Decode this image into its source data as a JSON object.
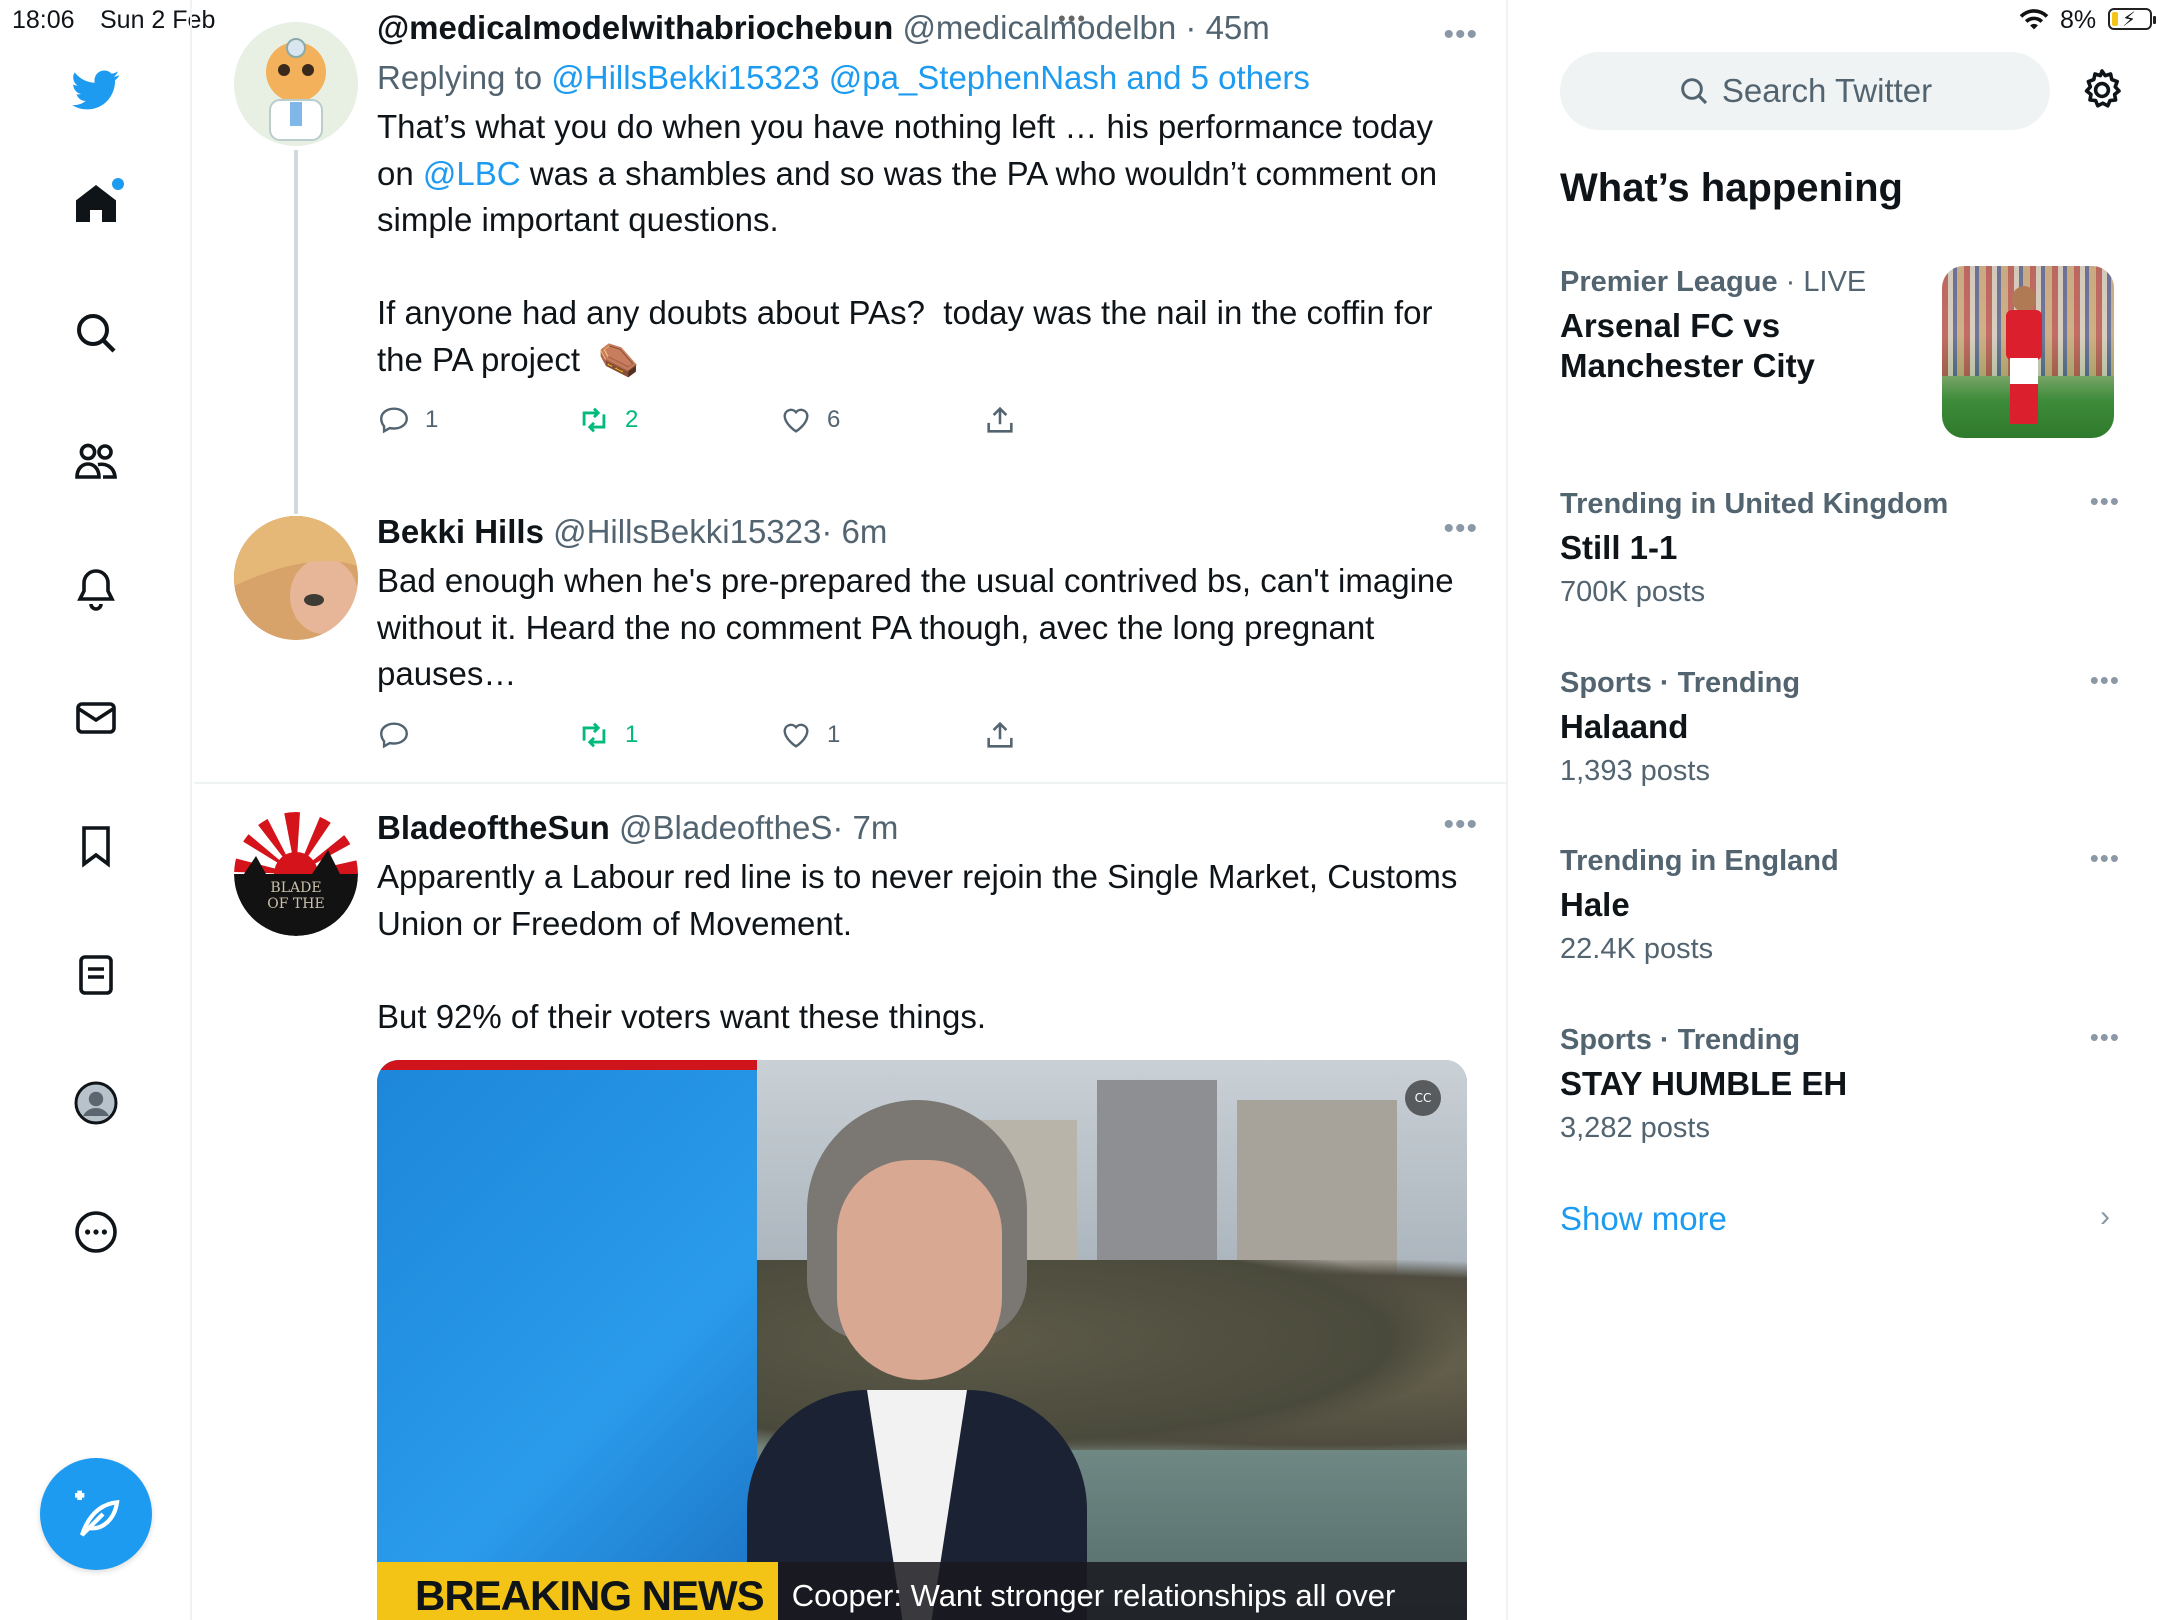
{
  "status_bar": {
    "time": "18:06",
    "date": "Sun 2 Feb",
    "dots": "•••",
    "battery": "8%"
  },
  "nav": {
    "items": [
      "twitter-logo",
      "home-icon",
      "search-icon",
      "communities-icon",
      "notifications-icon",
      "messages-icon",
      "bookmarks-icon",
      "lists-icon",
      "profile-icon",
      "more-icon"
    ],
    "compose_icon": "compose-icon"
  },
  "tweets": [
    {
      "name": "@medicalmodelwithabriochebun",
      "handle": "@medicalmodelbn",
      "time": "· 45m",
      "replying_prefix": "Replying to ",
      "replying_links": "@HillsBekki15323 @pa_StephenNash and 5 others",
      "text_a": "That’s what you do when you have nothing left … his performance today on ",
      "mention": "@LBC",
      "text_b": " was a shambles and so was the PA who wouldn’t comment on simple important questions.\n\nIf anyone had any doubts about PAs?  today was the nail in the coffin for the PA project  ⚰️",
      "replies": "1",
      "retweets": "2",
      "likes": "6"
    },
    {
      "name": "Bekki Hills",
      "handle": "@HillsBekki15323",
      "time": "· 6m",
      "text": "Bad enough when he's pre-prepared the usual contrived bs, can't imagine without it. Heard the no comment PA though, avec the long pregnant pauses…",
      "replies": "",
      "retweets": "1",
      "likes": "1"
    },
    {
      "name": "BladeoftheSun",
      "handle": "@BladeoftheS",
      "time": "· 7m",
      "text": "Apparently a Labour red line is to never rejoin the Single Market, Customs Union or Freedom of Movement.\n\nBut 92% of their voters want these things.",
      "media": {
        "breaking_label": "BREAKING NEWS",
        "ticker": "Cooper: Want stronger relationships all over world",
        "cc_label": "CC",
        "avatar_text_1": "BLADE",
        "avatar_text_2": "OF THE"
      }
    }
  ],
  "more_dots": "•••",
  "right": {
    "search_placeholder": "Search Twitter",
    "section_title": "What’s happening",
    "trends": [
      {
        "context": "Premier League",
        "context_suffix": " · LIVE",
        "topic": "Arsenal FC vs Manchester City",
        "posts": ""
      },
      {
        "context": "Trending in United Kingdom",
        "context_suffix": "",
        "topic": "Still 1-1",
        "posts": "700K posts"
      },
      {
        "context": "Sports · Trending",
        "context_suffix": "",
        "topic": "Halaand",
        "posts": "1,393 posts"
      },
      {
        "context": "Trending in England",
        "context_suffix": "",
        "topic": "Hale",
        "posts": "22.4K posts"
      },
      {
        "context": "Sports · Trending",
        "context_suffix": "",
        "topic": "STAY HUMBLE EH",
        "posts": "3,282 posts"
      }
    ],
    "show_more": "Show more"
  },
  "colors": {
    "accent": "#1d9bf0",
    "retweet": "#00ba7c",
    "muted": "#536471"
  }
}
